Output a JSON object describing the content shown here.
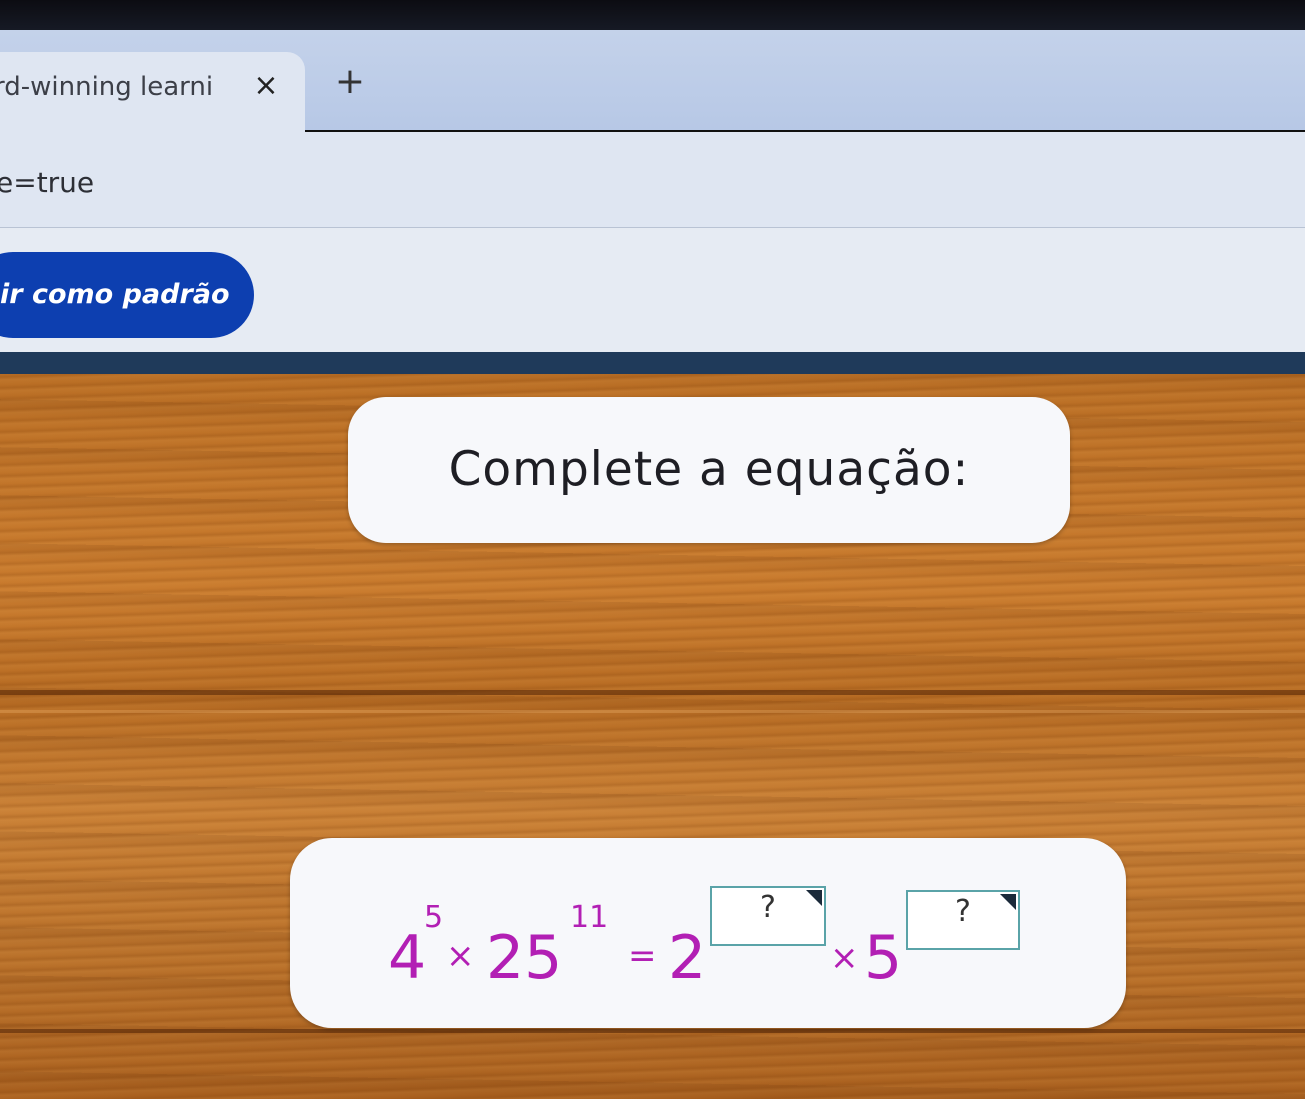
{
  "browser": {
    "tab_title": "rd-winning learnin",
    "tab_close_symbol": "×",
    "new_tab_symbol": "+",
    "url_fragment": "e=true",
    "default_button_label": "ir como padrão"
  },
  "exercise": {
    "prompt": "Complete a equação:",
    "equation": {
      "term1_base": "4",
      "term1_exp": "5",
      "times1": "×",
      "term2_base": "25",
      "term2_exp": "11",
      "equals": "=",
      "rhs_base1": "2",
      "times2": "×",
      "rhs_base2": "5",
      "answer1_placeholder": "?",
      "answer2_placeholder": "?"
    },
    "colors": {
      "equation": "#b21fb4",
      "answer_border": "#5aa3a8"
    }
  }
}
